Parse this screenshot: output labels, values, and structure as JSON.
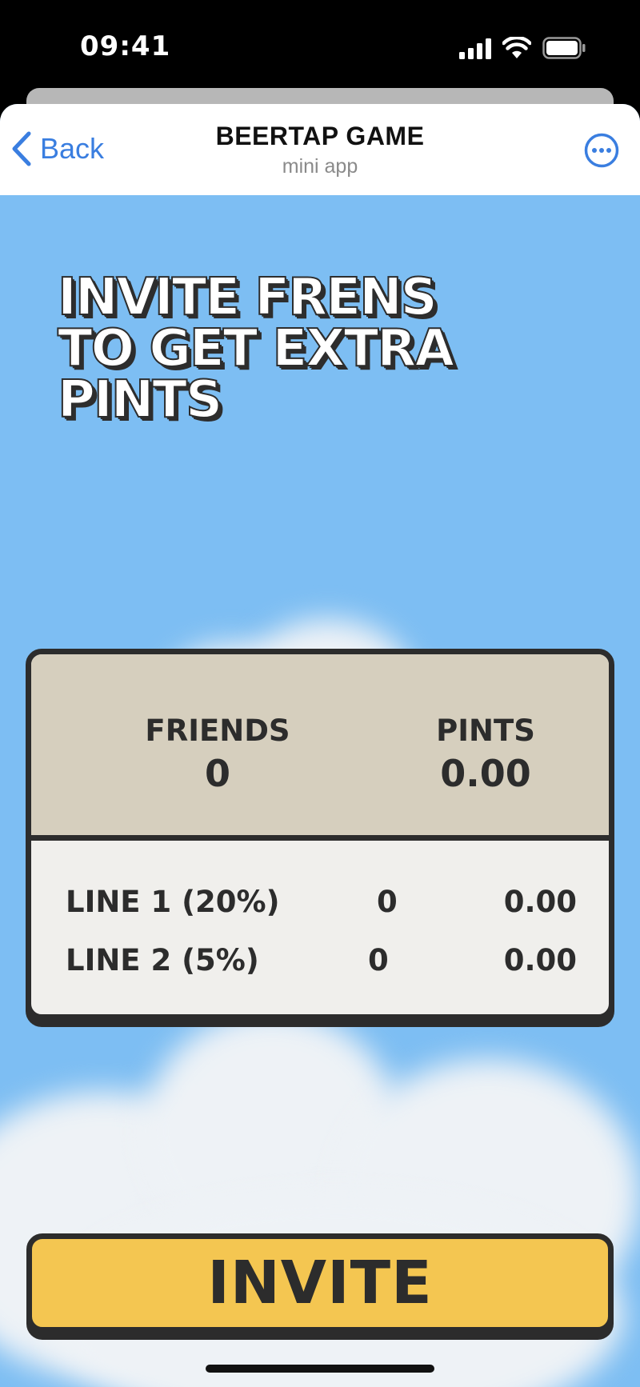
{
  "status_bar": {
    "time": "09:41"
  },
  "nav": {
    "back_label": "Back",
    "title": "BEERTAP GAME",
    "subtitle": "mini app"
  },
  "headline": {
    "line1": "INVITE FRENS",
    "line2": "TO GET EXTRA",
    "line3": "PINTS"
  },
  "stats": {
    "friends_label": "FRIENDS",
    "friends_value": "0",
    "pints_label": "PINTS",
    "pints_value": "0.00"
  },
  "lines": [
    {
      "label": "LINE 1 (20%)",
      "friends": "0",
      "pints": "0.00"
    },
    {
      "label": "LINE 2 (5%)",
      "friends": "0",
      "pints": "0.00"
    }
  ],
  "invite_button": {
    "label": "INVITE"
  },
  "colors": {
    "sky": "#7dbef3",
    "button_yellow": "#f4c651",
    "card_top": "#d6cfbe",
    "card_bottom": "#f0efec",
    "outline": "#2c2c2c",
    "link_blue": "#3a7ee0"
  },
  "icons": [
    "signal-icon",
    "wifi-icon",
    "battery-icon",
    "chevron-left-icon",
    "more-icon"
  ]
}
